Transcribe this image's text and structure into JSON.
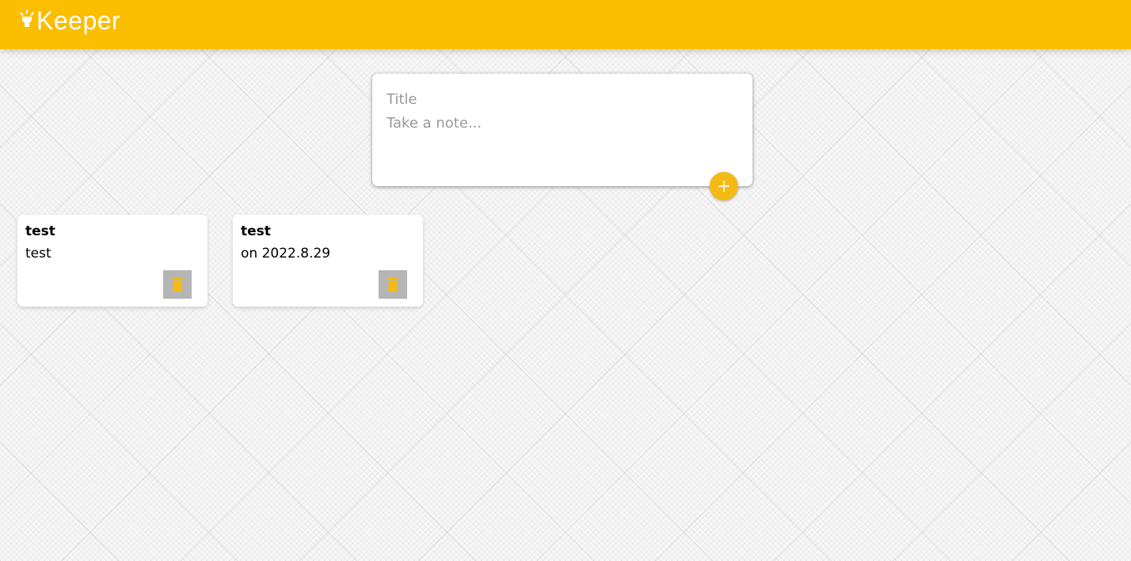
{
  "app": {
    "name": "Keeper",
    "brand_color": "#fbbe00",
    "logo_icon": "highlight-bulb-icon"
  },
  "create_note": {
    "title_placeholder": "Title",
    "content_placeholder": "Take a note...",
    "add_icon": "add-icon",
    "accent_color": "#f5ba13"
  },
  "notes": [
    {
      "title": "test",
      "content": "test",
      "delete_icon": "trash-icon"
    },
    {
      "title": "test",
      "content": "on 2022.8.29",
      "delete_icon": "trash-icon"
    }
  ]
}
